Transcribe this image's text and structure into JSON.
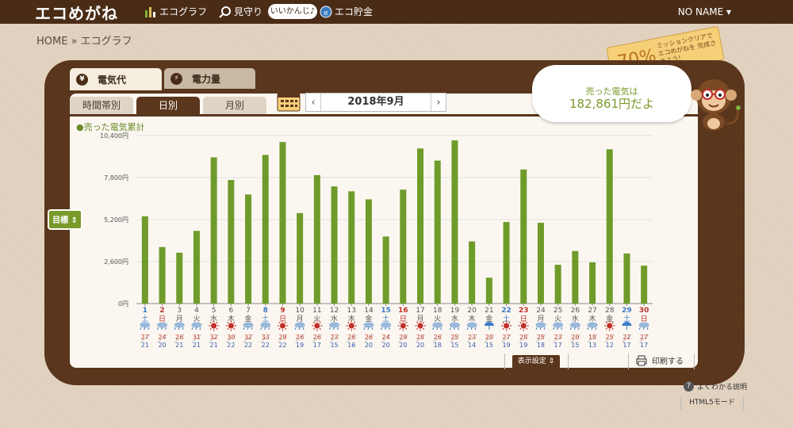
{
  "header": {
    "logo": "エコめがね",
    "nav": [
      {
        "label": "エコグラフ",
        "icon": "bar-chart-icon"
      },
      {
        "label": "見守り",
        "icon": "magnifier-icon"
      },
      {
        "label": "エコ貯金",
        "icon": "coin-icon"
      }
    ],
    "pill": "いいかんじ♪",
    "user": "NO NAME ▾"
  },
  "breadcrumb": "HOME » エコグラフ",
  "tabs": [
    {
      "label": "電気代",
      "icon_char": "¥"
    },
    {
      "label": "電力量",
      "icon_char": "⚡"
    }
  ],
  "subtabs": [
    "時間帯別",
    "日別",
    "月別"
  ],
  "date_nav": {
    "prev": "‹",
    "label": "2018年9月",
    "next": "›"
  },
  "summary": {
    "label": "売った電気は",
    "value": "182,861円だよ"
  },
  "mission": {
    "percent": "70%",
    "text": "ミッションクリアで エコめがねを 完成させよう!"
  },
  "legend": "●売った電気累計",
  "goal_button": "目標 ⇕",
  "settings_button": "表示設定 ⇕",
  "print_button": "印刷する",
  "faq": "よくわかる説明",
  "html5": "HTML5モード",
  "chart_data": {
    "type": "bar",
    "color": "#6e9b2a",
    "ylim": [
      0,
      10400
    ],
    "yticks": [
      "0円",
      "2,600円",
      "5,200円",
      "7,800円",
      "10,400円"
    ],
    "days": [
      "1",
      "2",
      "3",
      "4",
      "5",
      "6",
      "7",
      "8",
      "9",
      "10",
      "11",
      "12",
      "13",
      "14",
      "15",
      "16",
      "17",
      "18",
      "19",
      "20",
      "21",
      "22",
      "23",
      "24",
      "25",
      "26",
      "27",
      "28",
      "29",
      "30"
    ],
    "weekdays": [
      "土",
      "日",
      "月",
      "火",
      "水",
      "木",
      "金",
      "土",
      "日",
      "月",
      "火",
      "水",
      "木",
      "金",
      "土",
      "日",
      "月",
      "火",
      "水",
      "木",
      "金",
      "土",
      "日",
      "月",
      "火",
      "水",
      "木",
      "金",
      "土",
      "日"
    ],
    "values": [
      5400,
      3500,
      3150,
      4500,
      9050,
      7650,
      6750,
      9200,
      10000,
      5600,
      7950,
      7250,
      6950,
      6450,
      4150,
      7050,
      9600,
      8850,
      10100,
      3850,
      1600,
      5050,
      8300,
      5000,
      2400,
      3250,
      2550,
      9550,
      3100,
      2350
    ],
    "weather": [
      "rain",
      "rain",
      "rain",
      "rain",
      "sun",
      "sun",
      "rain",
      "rain",
      "sun",
      "rain",
      "sun",
      "rain",
      "sun",
      "rain",
      "rain",
      "sun",
      "sun",
      "rain",
      "rain",
      "rain",
      "umbrella",
      "sun",
      "sun",
      "rain",
      "rain",
      "rain",
      "rain",
      "sun",
      "umbrella",
      "rain"
    ],
    "temp_high": [
      "27",
      "24",
      "26",
      "31",
      "32",
      "30",
      "32",
      "33",
      "29",
      "26",
      "26",
      "23",
      "26",
      "26",
      "24",
      "29",
      "28",
      "26",
      "25",
      "23",
      "20",
      "27",
      "28",
      "25",
      "23",
      "20",
      "18",
      "25",
      "22",
      "27"
    ],
    "temp_low": [
      "21",
      "20",
      "21",
      "21",
      "21",
      "22",
      "22",
      "22",
      "22",
      "19",
      "17",
      "15",
      "16",
      "20",
      "20",
      "20",
      "20",
      "18",
      "15",
      "14",
      "15",
      "19",
      "19",
      "18",
      "17",
      "15",
      "13",
      "12",
      "17",
      "17"
    ]
  }
}
